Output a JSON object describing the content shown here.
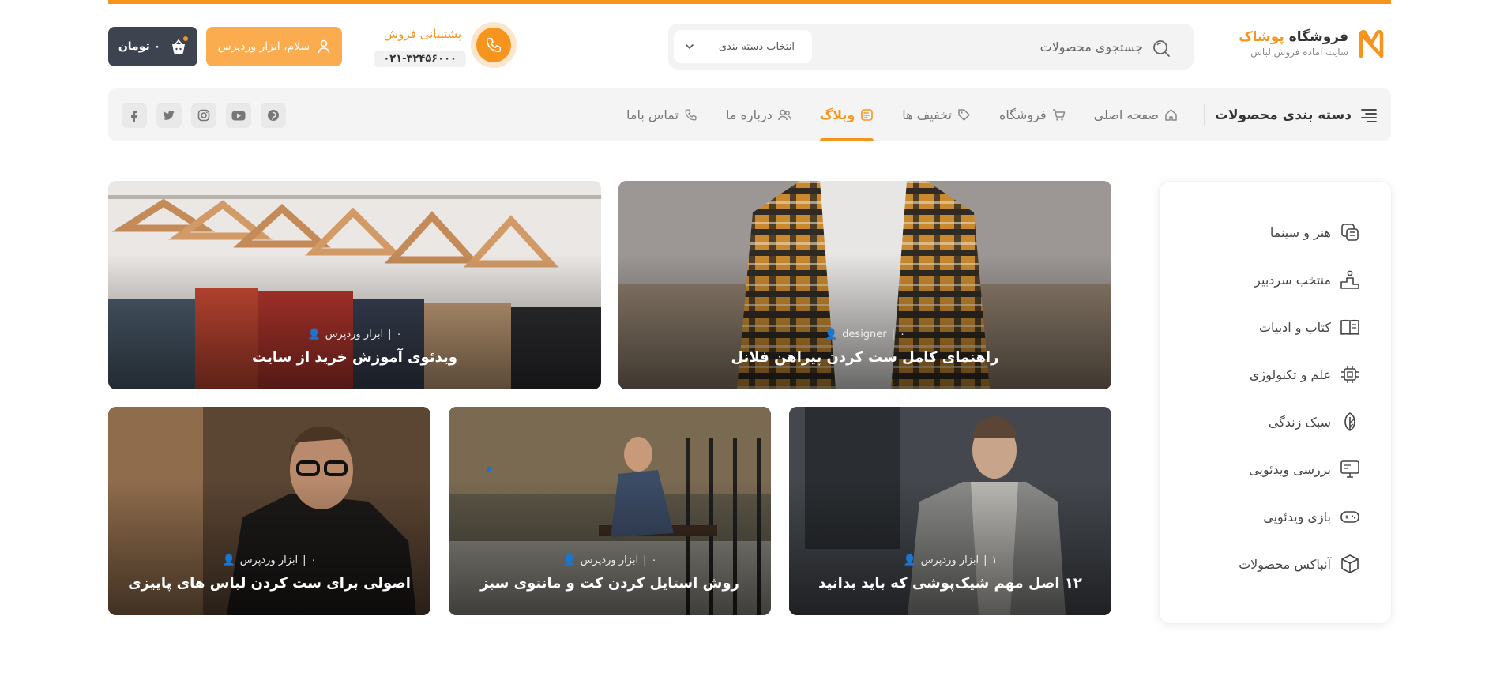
{
  "colors": {
    "accent": "#f7941d",
    "dark": "#3d4450",
    "nav_bg": "#f4f4f4"
  },
  "header": {
    "logo_title_main": "فروشگاه",
    "logo_title_accent": "پوشاک",
    "logo_subtitle": "سایت آماده فروش لباس",
    "search_placeholder": "جستجوی محصولات",
    "category_select": "انتخاب دسته بندی",
    "support_title": "پشتیبانی فروش",
    "support_phone": "۰۲۱-۳۲۴۵۶۰۰۰",
    "login_label": "سلام، ابزار وردپرس",
    "cart_label": "۰ تومان"
  },
  "nav": {
    "categories_label": "دسته بندی محصولات",
    "items": [
      {
        "label": "صفحه اصلی",
        "icon": "home-icon"
      },
      {
        "label": "فروشگاه",
        "icon": "cart-icon"
      },
      {
        "label": "تخفیف ها",
        "icon": "tag-icon"
      },
      {
        "label": "وبلاگ",
        "icon": "blog-icon",
        "active": true
      },
      {
        "label": "درباره ما",
        "icon": "users-icon"
      },
      {
        "label": "تماس باما",
        "icon": "phone-icon"
      }
    ],
    "social": [
      "facebook-icon",
      "twitter-icon",
      "instagram-icon",
      "youtube-icon",
      "pinterest-icon"
    ]
  },
  "sidebar": {
    "items": [
      {
        "label": "هنر و سینما",
        "icon": "cinema-icon"
      },
      {
        "label": "منتخب سردبیر",
        "icon": "podium-icon"
      },
      {
        "label": "کتاب و ادبیات",
        "icon": "book-icon"
      },
      {
        "label": "علم و تکنولوژی",
        "icon": "chip-icon"
      },
      {
        "label": "سبک زندگی",
        "icon": "leaf-icon"
      },
      {
        "label": "بررسی ویدئویی",
        "icon": "monitor-icon"
      },
      {
        "label": "بازی ویدئویی",
        "icon": "gamepad-icon"
      },
      {
        "label": "آنباکس محصولات",
        "icon": "box-icon"
      }
    ]
  },
  "posts": [
    {
      "title": "راهنمای کامل ست کردن پیراهن فلانل",
      "author": "designer",
      "comments": "۰"
    },
    {
      "title": "ویدئوی آموزش خرید از سایت",
      "author": "ابزار وردپرس",
      "comments": "۰"
    },
    {
      "title": "۱۲ اصل مهم شیک‌پوشی که باید بدانید",
      "author": "ابزار وردپرس",
      "comments": "۱"
    },
    {
      "title": "روش استایل کردن کت و مانتوی سبز",
      "author": "ابزار وردپرس",
      "comments": "۰"
    },
    {
      "title": "اصولی برای ست کردن لباس های پاییزی",
      "author": "ابزار وردپرس",
      "comments": "۰"
    }
  ]
}
